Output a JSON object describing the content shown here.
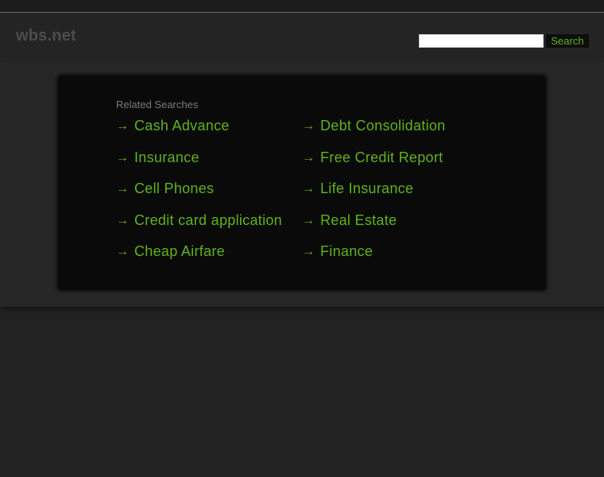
{
  "header": {
    "site_name": "wbs.net",
    "search_placeholder": "",
    "search_value": "",
    "search_button_label": "Search"
  },
  "related": {
    "heading": "Related Searches",
    "left_column": [
      "Cash Advance",
      "Insurance",
      "Cell Phones",
      "Credit card application",
      "Cheap Airfare"
    ],
    "right_column": [
      "Debt Consolidation",
      "Free Credit Report",
      "Life Insurance",
      "Real Estate",
      "Finance"
    ],
    "link_icon": "arrow-right-icon",
    "link_icon_glyph": "→"
  },
  "colors": {
    "background": "#222222",
    "panel": "#0a0a0a",
    "link_green": "#5fb31a",
    "heading_gray": "#7a7a7a",
    "logo_gray": "#4d4d4d"
  }
}
